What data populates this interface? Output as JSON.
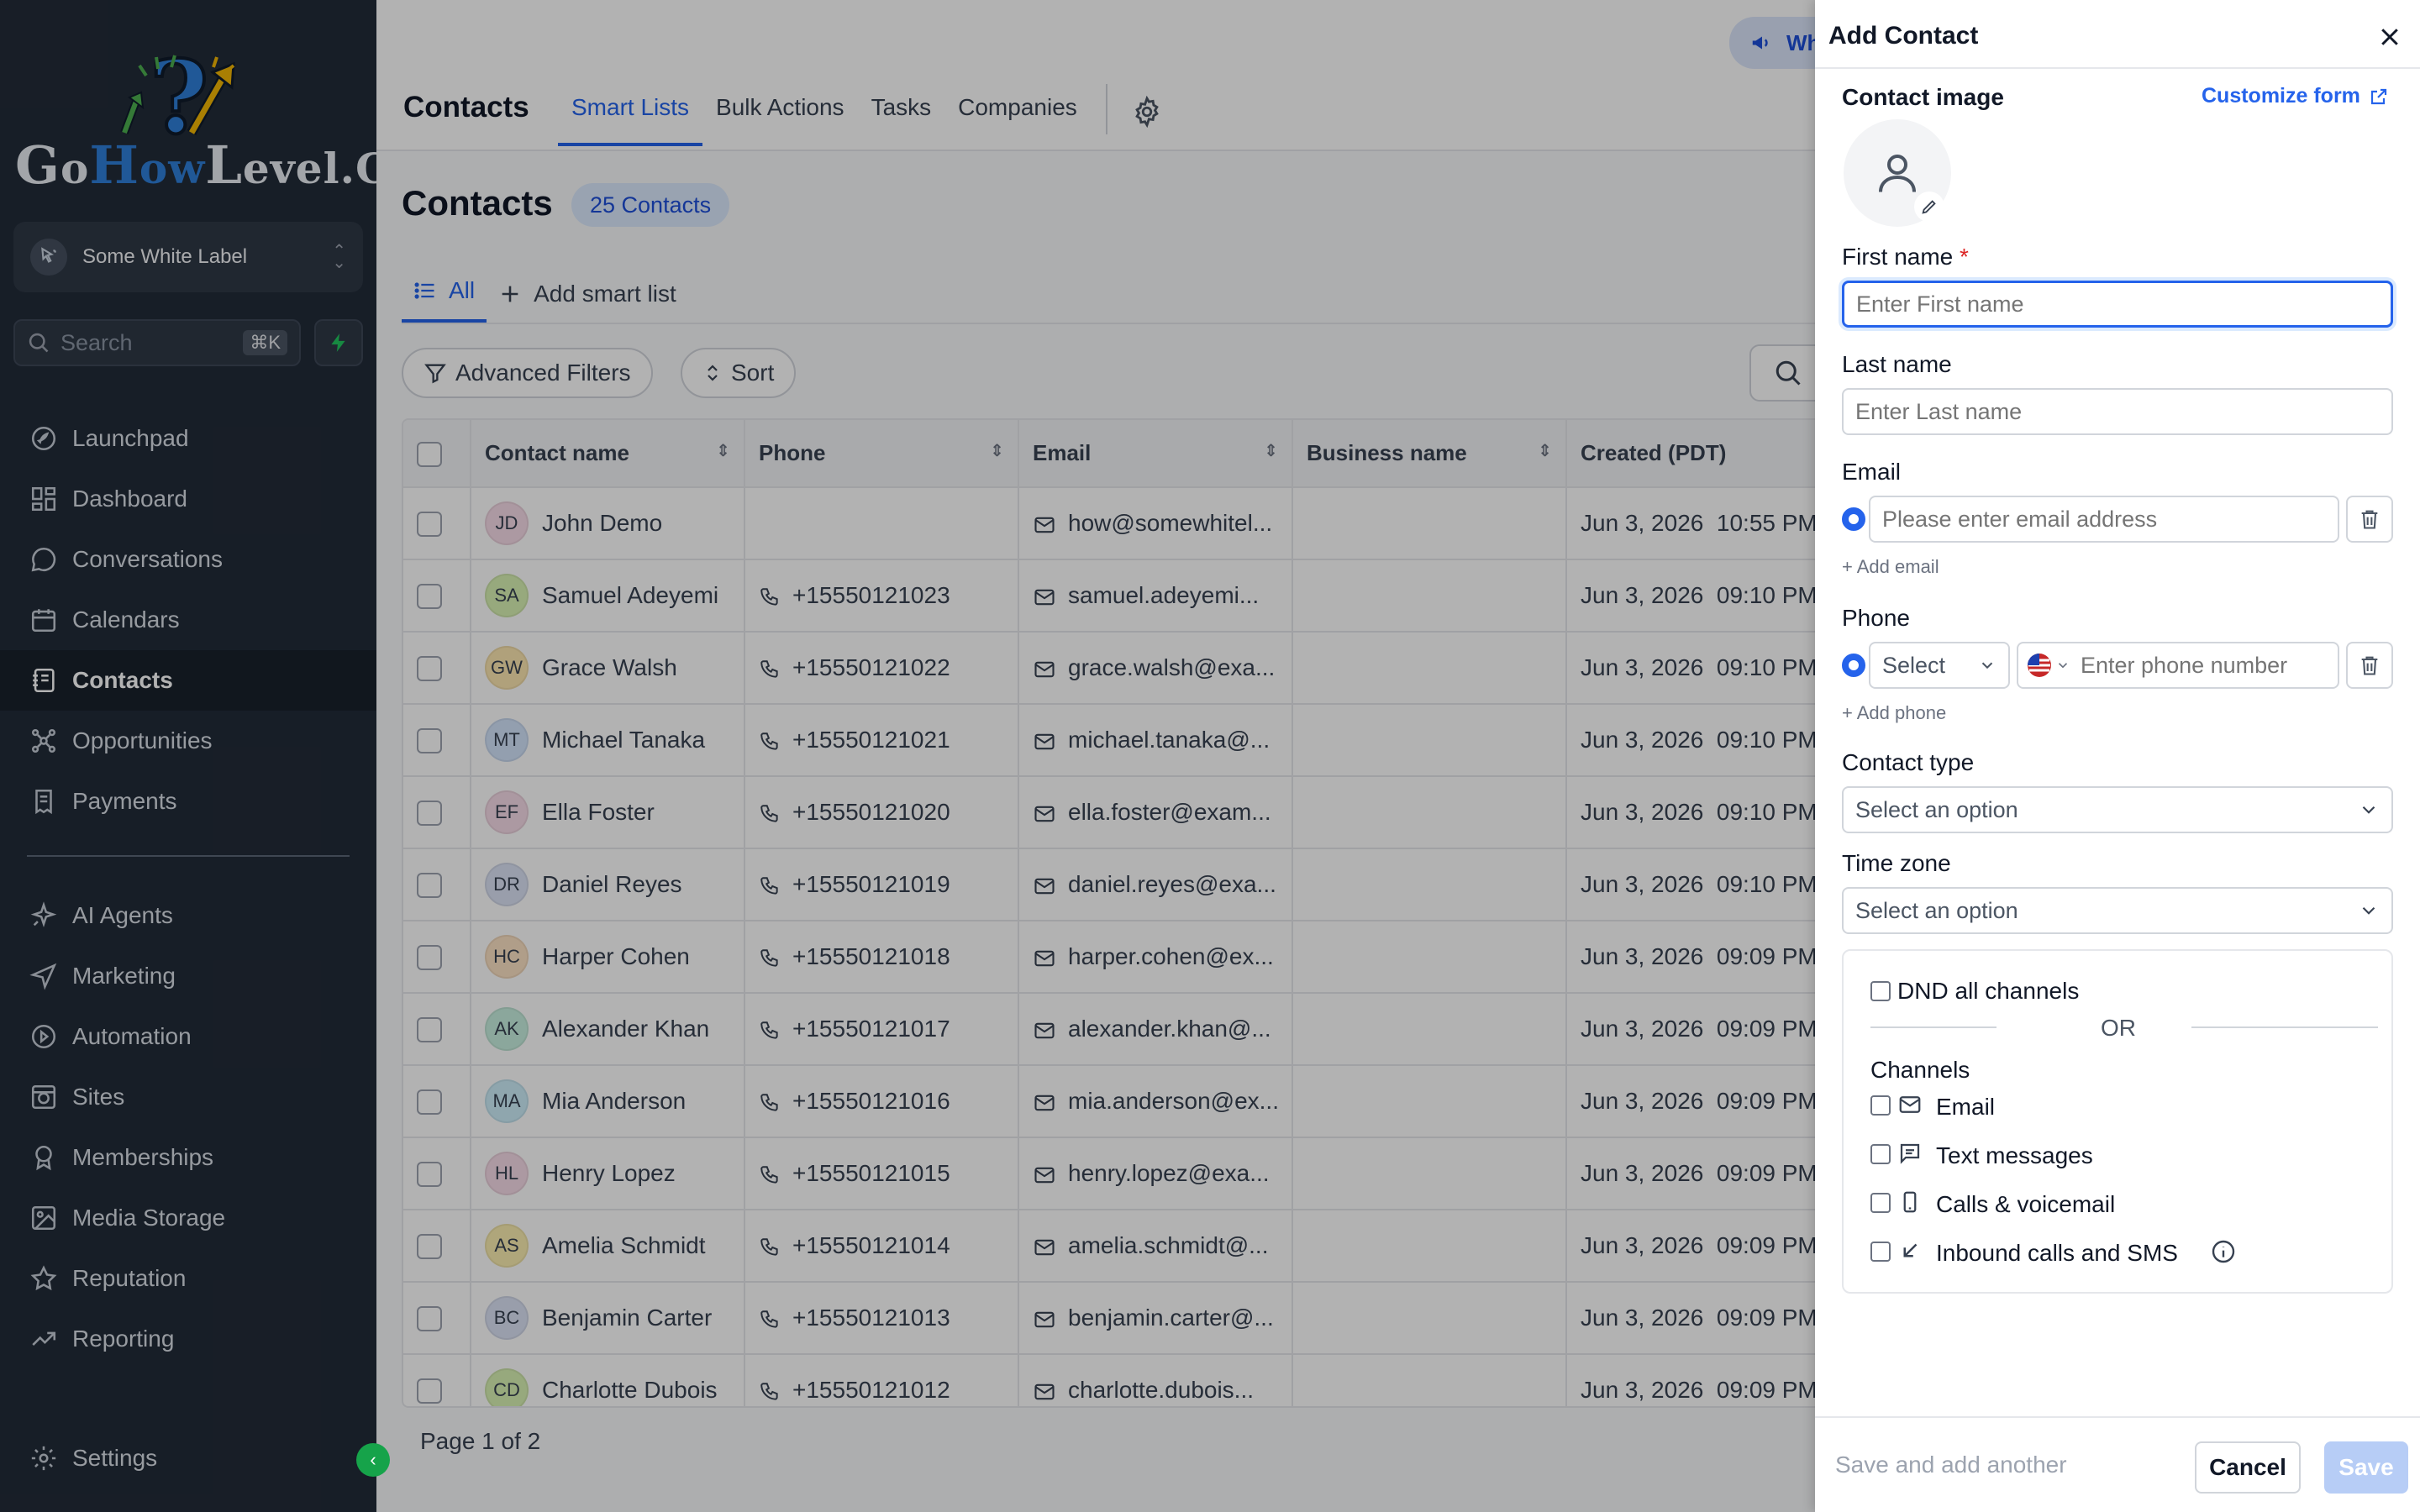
{
  "brand": {
    "logo_text": "GoHowLevel.com"
  },
  "sidebar": {
    "account_name": "Some White Label",
    "search_placeholder": "Search",
    "search_shortcut": "⌘K",
    "nav_primary": [
      {
        "label": "Launchpad",
        "icon": "rocket-icon"
      },
      {
        "label": "Dashboard",
        "icon": "grid-icon"
      },
      {
        "label": "Conversations",
        "icon": "chat-bubble-icon"
      },
      {
        "label": "Calendars",
        "icon": "calendar-icon"
      },
      {
        "label": "Contacts",
        "icon": "contact-book-icon",
        "active": true
      },
      {
        "label": "Opportunities",
        "icon": "network-icon"
      },
      {
        "label": "Payments",
        "icon": "receipt-icon"
      }
    ],
    "nav_secondary": [
      {
        "label": "AI Agents",
        "icon": "sparkle-icon"
      },
      {
        "label": "Marketing",
        "icon": "send-icon"
      },
      {
        "label": "Automation",
        "icon": "automation-icon"
      },
      {
        "label": "Sites",
        "icon": "globe-icon"
      },
      {
        "label": "Memberships",
        "icon": "badge-icon"
      },
      {
        "label": "Media Storage",
        "icon": "image-icon"
      },
      {
        "label": "Reputation",
        "icon": "star-icon"
      },
      {
        "label": "Reporting",
        "icon": "trend-icon"
      }
    ],
    "settings_label": "Settings"
  },
  "topbar": {
    "title": "Contacts",
    "tabs": [
      "Smart Lists",
      "Bulk Actions",
      "Tasks",
      "Companies"
    ],
    "active_tab": "Smart Lists",
    "whats_new_label": "Wh"
  },
  "page": {
    "title": "Contacts",
    "count_badge": "25 Contacts",
    "list_tabs": {
      "all": "All",
      "add": "Add smart list"
    },
    "advanced_filters": "Advanced Filters",
    "sort": "Sort",
    "pagination": "Page 1 of 2"
  },
  "table": {
    "columns": [
      "Contact name",
      "Phone",
      "Email",
      "Business name",
      "Created (PDT)"
    ],
    "rows": [
      {
        "initials": "JD",
        "color": "#f7dce8",
        "name": "John Demo",
        "phone": "",
        "email": "how@somewhitel...",
        "business": "",
        "created": "Jun 3, 2026  10:55 PM"
      },
      {
        "initials": "SA",
        "color": "#d9f2b3",
        "name": "Samuel Adeyemi",
        "phone": "+15550121023",
        "email": "samuel.adeyemi...",
        "business": "",
        "created": "Jun 3, 2026  09:10 PM"
      },
      {
        "initials": "GW",
        "color": "#fde7b0",
        "name": "Grace Walsh",
        "phone": "+15550121022",
        "email": "grace.walsh@exa...",
        "business": "",
        "created": "Jun 3, 2026  09:10 PM"
      },
      {
        "initials": "MT",
        "color": "#d3e4fb",
        "name": "Michael Tanaka",
        "phone": "+15550121021",
        "email": "michael.tanaka@...",
        "business": "",
        "created": "Jun 3, 2026  09:10 PM"
      },
      {
        "initials": "EF",
        "color": "#f7dce8",
        "name": "Ella Foster",
        "phone": "+15550121020",
        "email": "ella.foster@exam...",
        "business": "",
        "created": "Jun 3, 2026  09:10 PM"
      },
      {
        "initials": "DR",
        "color": "#dbe3f5",
        "name": "Daniel Reyes",
        "phone": "+15550121019",
        "email": "daniel.reyes@exa...",
        "business": "",
        "created": "Jun 3, 2026  09:10 PM"
      },
      {
        "initials": "HC",
        "color": "#fde2c4",
        "name": "Harper Cohen",
        "phone": "+15550121018",
        "email": "harper.cohen@ex...",
        "business": "",
        "created": "Jun 3, 2026  09:09 PM"
      },
      {
        "initials": "AK",
        "color": "#c8f0e0",
        "name": "Alexander Khan",
        "phone": "+15550121017",
        "email": "alexander.khan@...",
        "business": "",
        "created": "Jun 3, 2026  09:09 PM"
      },
      {
        "initials": "MA",
        "color": "#cdeefa",
        "name": "Mia Anderson",
        "phone": "+15550121016",
        "email": "mia.anderson@ex...",
        "business": "",
        "created": "Jun 3, 2026  09:09 PM"
      },
      {
        "initials": "HL",
        "color": "#f7dce8",
        "name": "Henry Lopez",
        "phone": "+15550121015",
        "email": "henry.lopez@exa...",
        "business": "",
        "created": "Jun 3, 2026  09:09 PM"
      },
      {
        "initials": "AS",
        "color": "#fbeeb0",
        "name": "Amelia Schmidt",
        "phone": "+15550121014",
        "email": "amelia.schmidt@...",
        "business": "",
        "created": "Jun 3, 2026  09:09 PM"
      },
      {
        "initials": "BC",
        "color": "#dbe3f5",
        "name": "Benjamin Carter",
        "phone": "+15550121013",
        "email": "benjamin.carter@...",
        "business": "",
        "created": "Jun 3, 2026  09:09 PM"
      },
      {
        "initials": "CD",
        "color": "#d9f2b3",
        "name": "Charlotte Dubois",
        "phone": "+15550121012",
        "email": "charlotte.dubois...",
        "business": "",
        "created": "Jun 3, 2026  09:09 PM"
      }
    ]
  },
  "drawer": {
    "title": "Add Contact",
    "contact_image_label": "Contact image",
    "customize_form": "Customize form",
    "first_name_label": "First name",
    "required_mark": "*",
    "first_name_placeholder": "Enter First name",
    "last_name_label": "Last name",
    "last_name_placeholder": "Enter Last name",
    "email_label": "Email",
    "email_placeholder": "Please enter email address",
    "add_email": "+ Add email",
    "phone_label": "Phone",
    "phone_type_placeholder": "Select",
    "phone_placeholder": "Enter phone number",
    "add_phone": "+ Add phone",
    "contact_type_label": "Contact type",
    "contact_type_placeholder": "Select an option",
    "time_zone_label": "Time zone",
    "time_zone_placeholder": "Select an option",
    "dnd_all": "DND all channels",
    "or": "OR",
    "channels_label": "Channels",
    "channels": [
      "Email",
      "Text messages",
      "Calls & voicemail",
      "Inbound calls and SMS"
    ],
    "save_and_add": "Save and add another",
    "cancel": "Cancel",
    "save": "Save"
  },
  "colors": {
    "accent": "#2563eb",
    "sidebar_bg": "#222b38",
    "danger": "#dc2626"
  }
}
